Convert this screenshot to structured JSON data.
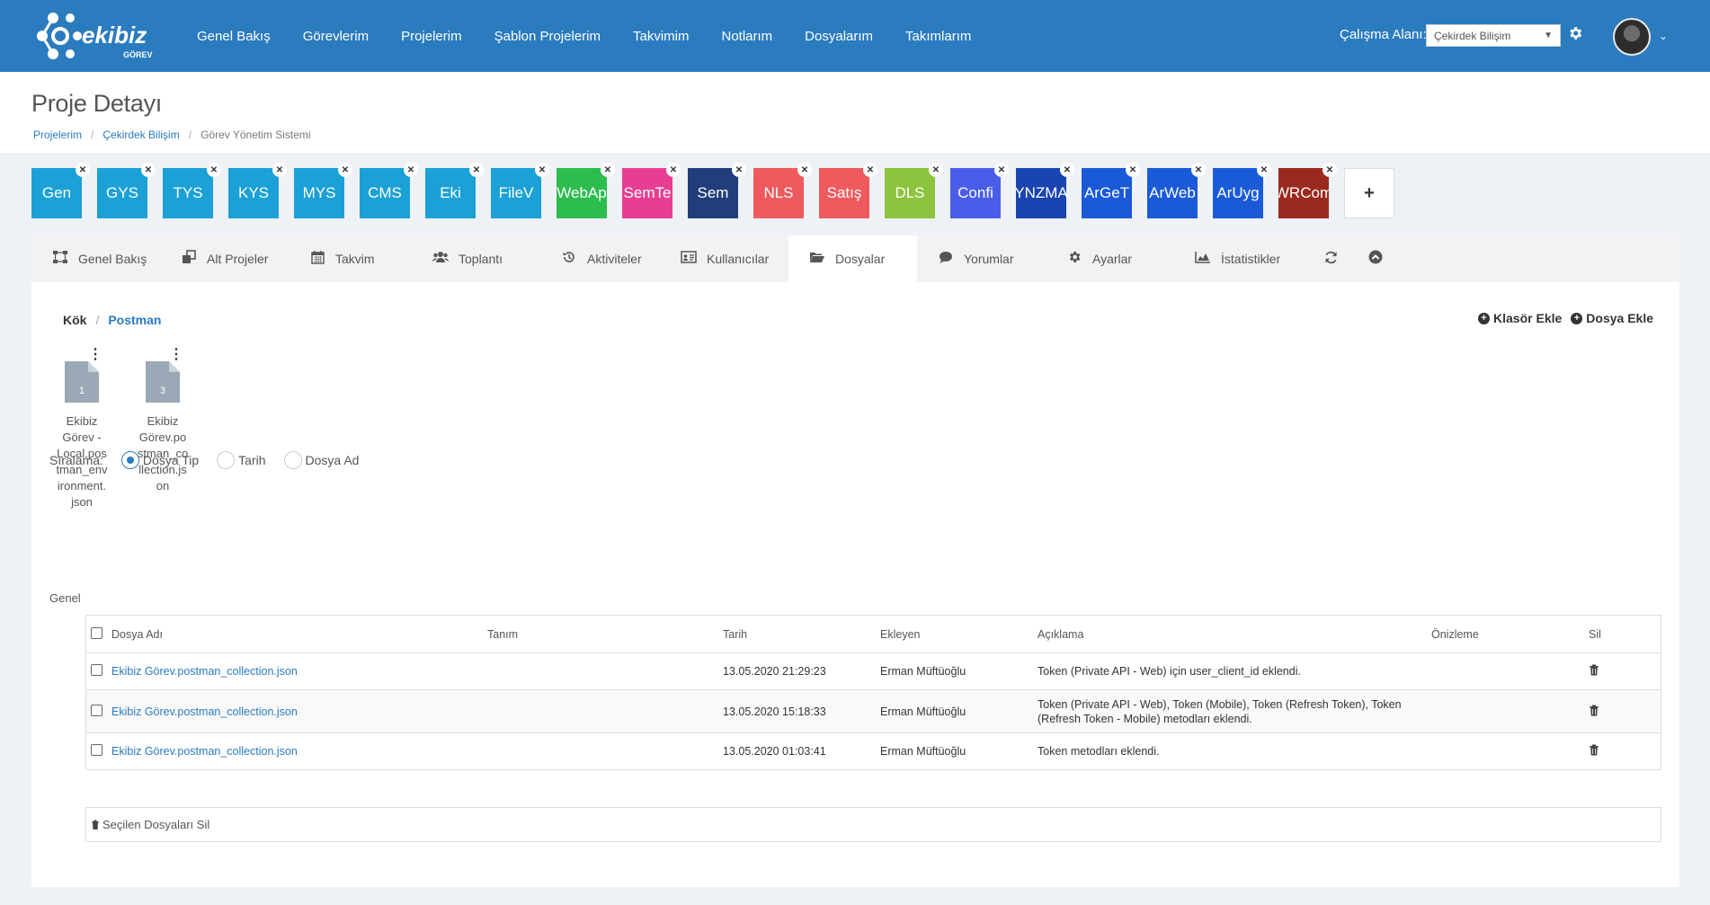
{
  "app": {
    "logo_text": "ekibiz",
    "logo_sub": "GÖREV"
  },
  "nav": {
    "items": [
      "Genel Bakış",
      "Görevlerim",
      "Projelerim",
      "Şablon Projelerim",
      "Takvimim",
      "Notlarım",
      "Dosyalarım",
      "Takımlarım"
    ],
    "workspace_label": "Çalışma Alanı:",
    "workspace_value": "Çekirdek Bilişim"
  },
  "page": {
    "title": "Proje Detayı",
    "breadcrumb": [
      "Projelerim",
      "Çekirdek Bilişim",
      "Görev Yönetim Sistemi"
    ]
  },
  "projects": [
    {
      "label": "Gen",
      "color": "#1ba1d6"
    },
    {
      "label": "GYS",
      "color": "#1ba1d6"
    },
    {
      "label": "TYS",
      "color": "#1ba1d6"
    },
    {
      "label": "KYS",
      "color": "#1ba1d6"
    },
    {
      "label": "MYS",
      "color": "#1ba1d6"
    },
    {
      "label": "CMS",
      "color": "#1ba1d6"
    },
    {
      "label": "Eki",
      "color": "#1ba1d6"
    },
    {
      "label": "FileV",
      "color": "#1ba1d6"
    },
    {
      "label": "WebAp",
      "color": "#2dbd4f"
    },
    {
      "label": "SemTe",
      "color": "#e73e93"
    },
    {
      "label": "Sem",
      "color": "#203e79"
    },
    {
      "label": "NLS",
      "color": "#ee5a5e"
    },
    {
      "label": "Satış",
      "color": "#ee5a5e"
    },
    {
      "label": "DLS",
      "color": "#8cc43d"
    },
    {
      "label": "Confi",
      "color": "#4a5de8"
    },
    {
      "label": "YNZMA",
      "color": "#1a44b0"
    },
    {
      "label": "ArGeT",
      "color": "#1a5ad8"
    },
    {
      "label": "ArWeb",
      "color": "#1a5ad8"
    },
    {
      "label": "ArUyg",
      "color": "#1a5ad8"
    },
    {
      "label": "WRCom",
      "color": "#9a2a1f"
    }
  ],
  "add_project_label": "+",
  "tabs": [
    {
      "label": "Genel Bakış",
      "icon": "sitemap-icon"
    },
    {
      "label": "Alt Projeler",
      "icon": "copy-icon"
    },
    {
      "label": "Takvim",
      "icon": "calendar-icon"
    },
    {
      "label": "Toplantı",
      "icon": "users-icon"
    },
    {
      "label": "Aktiviteler",
      "icon": "history-icon"
    },
    {
      "label": "Kullanıcılar",
      "icon": "id-card-icon"
    },
    {
      "label": "Dosyalar",
      "icon": "folder-open-icon",
      "active": true
    },
    {
      "label": "Yorumlar",
      "icon": "comment-icon"
    },
    {
      "label": "Ayarlar",
      "icon": "cog-icon"
    },
    {
      "label": "İstatistikler",
      "icon": "area-chart-icon"
    }
  ],
  "files_crumb": {
    "root": "Kök",
    "current": "Postman"
  },
  "actions": {
    "add_folder": "Klasör Ekle",
    "add_file": "Dosya Ekle"
  },
  "files": [
    {
      "name": "Ekibiz Görev - Local.postman_environment.json",
      "lines": [
        "Ekibiz",
        "Görev -",
        "Local.pos",
        "tman_env",
        "ironment.",
        "json"
      ],
      "count": "1"
    },
    {
      "name": "Ekibiz Görev.postman_collection.json",
      "lines": [
        "Ekibiz",
        "Görev.po",
        "stman_co",
        "llection.js",
        "on"
      ],
      "count": "3"
    }
  ],
  "sort": {
    "label": "Sıralama:",
    "options": [
      "Dosya Tip",
      "Tarih",
      "Dosya Ad"
    ],
    "selected": "Dosya Tip"
  },
  "group_title": "Genel",
  "table": {
    "headers": [
      "Dosya Adı",
      "Tanım",
      "Tarih",
      "Ekleyen",
      "Açıklama",
      "Önizleme",
      "Sil"
    ],
    "rows": [
      {
        "name": "Ekibiz Görev.postman_collection.json",
        "tanim": "",
        "tarih": "13.05.2020 21:29:23",
        "ekleyen": "Erman Müftüoğlu",
        "aciklama": "Token (Private API - Web) için user_client_id eklendi."
      },
      {
        "name": "Ekibiz Görev.postman_collection.json",
        "tanim": "",
        "tarih": "13.05.2020 15:18:33",
        "ekleyen": "Erman Müftüoğlu",
        "aciklama": "Token (Private API - Web), Token (Mobile), Token (Refresh Token), Token (Refresh Token - Mobile) metodları eklendi."
      },
      {
        "name": "Ekibiz Görev.postman_collection.json",
        "tanim": "",
        "tarih": "13.05.2020 01:03:41",
        "ekleyen": "Erman Müftüoğlu",
        "aciklama": "Token metodları eklendi."
      }
    ]
  },
  "delete_selected": "Seçilen Dosyaları Sil"
}
